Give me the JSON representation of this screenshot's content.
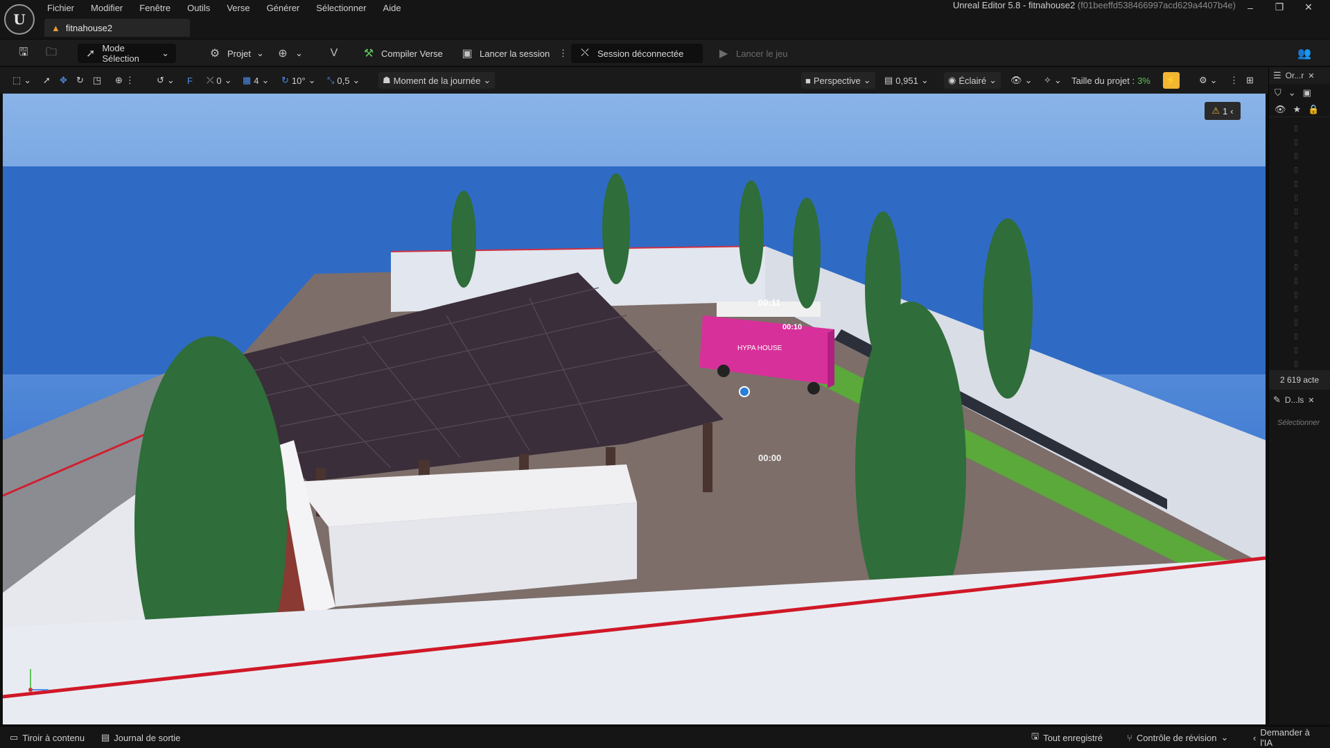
{
  "app": {
    "window_title": "Unreal Editor 5.8 - fitnahouse2",
    "window_hash": "(f01beeffd538466997acd629a4407b4e)",
    "document_tab": "fitnahouse2"
  },
  "menu": [
    "Fichier",
    "Modifier",
    "Fenêtre",
    "Outils",
    "Verse",
    "Générer",
    "Sélectionner",
    "Aide"
  ],
  "toolbar": {
    "mode_label": "Mode Sélection",
    "project_label": "Projet",
    "compile_label": "Compiler Verse",
    "session_label": "Lancer la session",
    "status_label": "Session déconnectée",
    "play_label": "Lancer le jeu"
  },
  "viewport_toolbar": {
    "rotation_snap": "0",
    "grid_snap": "4",
    "angle_snap": "10°",
    "scale_snap": "0,5",
    "time_of_day": "Moment de la journée",
    "view_mode": "Perspective",
    "camera_speed": "0,951",
    "lighting": "Éclairé",
    "project_size_label": "Taille du projet :",
    "project_size_value": "3%"
  },
  "viewport": {
    "warning_count": "1",
    "bus_timer_top": "00:11",
    "bus_timer_side": "00:10",
    "ground_timer": "00:00",
    "bus_brand": "HYPA HOUSE"
  },
  "outliner": {
    "tab_label": "Or...r",
    "actor_count": "2 619 acte",
    "details_tab": "D...ls",
    "details_hint": "Sélectionner"
  },
  "statusbar": {
    "content_drawer": "Tiroir à contenu",
    "output_log": "Journal de sortie",
    "saved_all": "Tout enregistré",
    "revision": "Contrôle de révision",
    "ask_ai": "Demander à l'IA"
  },
  "colors": {
    "accent_blue": "#4a8ff0",
    "status_green": "#5fc35a",
    "warning_orange": "#e9a030",
    "project_size_highlight": "#f2b632"
  }
}
